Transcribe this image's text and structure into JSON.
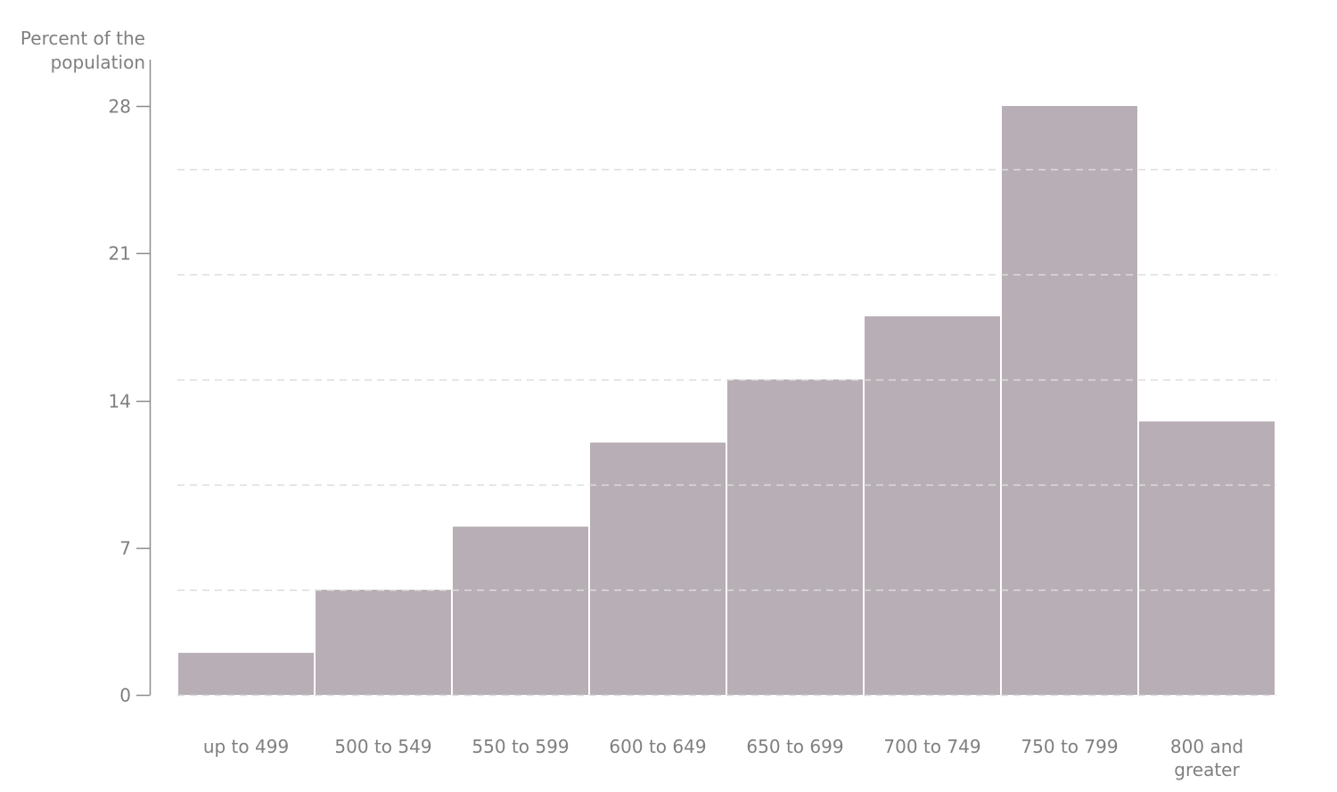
{
  "chart_data": {
    "type": "bar",
    "subtype": "histogram",
    "title": "",
    "xlabel": "",
    "ylabel": "Percent of the population",
    "ylabel_lines": [
      "Percent of the",
      "population"
    ],
    "categories": [
      "up to 499",
      "500 to 549",
      "550 to 599",
      "600 to 649",
      "650 to 699",
      "700 to 749",
      "750 to 799",
      "800 and greater"
    ],
    "category_label_lines": [
      [
        "up to 499"
      ],
      [
        "500 to 549"
      ],
      [
        "550 to 599"
      ],
      [
        "600 to 649"
      ],
      [
        "650 to 699"
      ],
      [
        "700 to 749"
      ],
      [
        "750 to 799"
      ],
      [
        "800 and",
        "greater"
      ]
    ],
    "values": [
      2,
      5,
      8,
      12,
      15,
      18,
      28,
      13
    ],
    "ylim": [
      0,
      28
    ],
    "yticks": [
      0,
      7,
      14,
      21,
      28
    ],
    "ytick_labels": [
      "0",
      "7",
      "14",
      "21",
      "28"
    ],
    "gridlines": [
      5,
      10,
      15,
      20,
      25
    ],
    "grid": true,
    "grid_style": "dashed",
    "legend": "none",
    "colors": {
      "bar": "#b8aeb5",
      "bar_separator": "#ffffff",
      "axis": "#8c8c8c",
      "grid": "#dcdcdc",
      "text": "#7f7f7f"
    }
  }
}
